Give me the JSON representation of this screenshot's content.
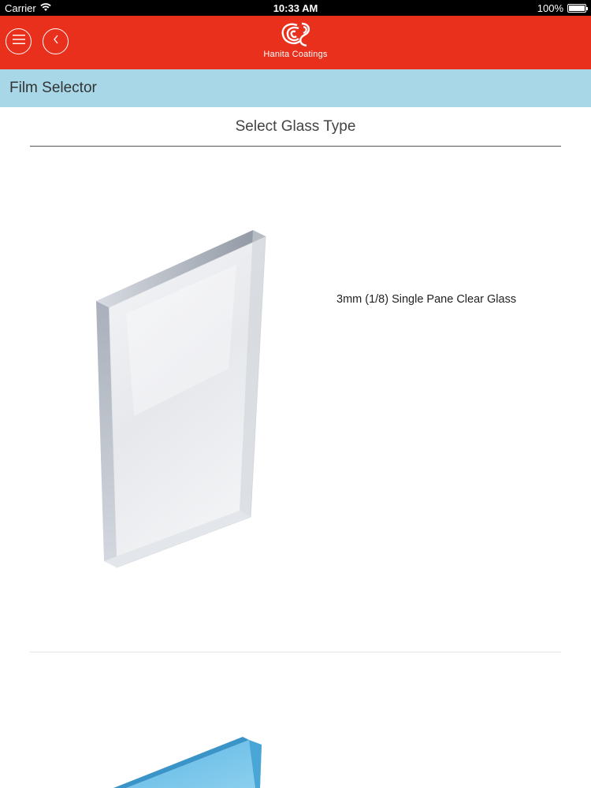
{
  "status_bar": {
    "carrier": "Carrier",
    "time": "10:33 AM",
    "battery": "100%",
    "battery_level": 1.0
  },
  "header": {
    "background_color": "#e8301c",
    "menu_icon": "hamburger-menu-icon",
    "back_icon": "chevron-left-icon",
    "logo_text": "Hanita Coatings"
  },
  "sub_header": {
    "title": "Film Selector",
    "background_color": "#a8d8e8"
  },
  "main": {
    "section_title": "Select Glass Type",
    "glass_types": [
      {
        "label": "3mm (1/8) Single Pane Clear Glass",
        "tint": "clear"
      },
      {
        "label": "",
        "tint": "blue"
      }
    ]
  }
}
